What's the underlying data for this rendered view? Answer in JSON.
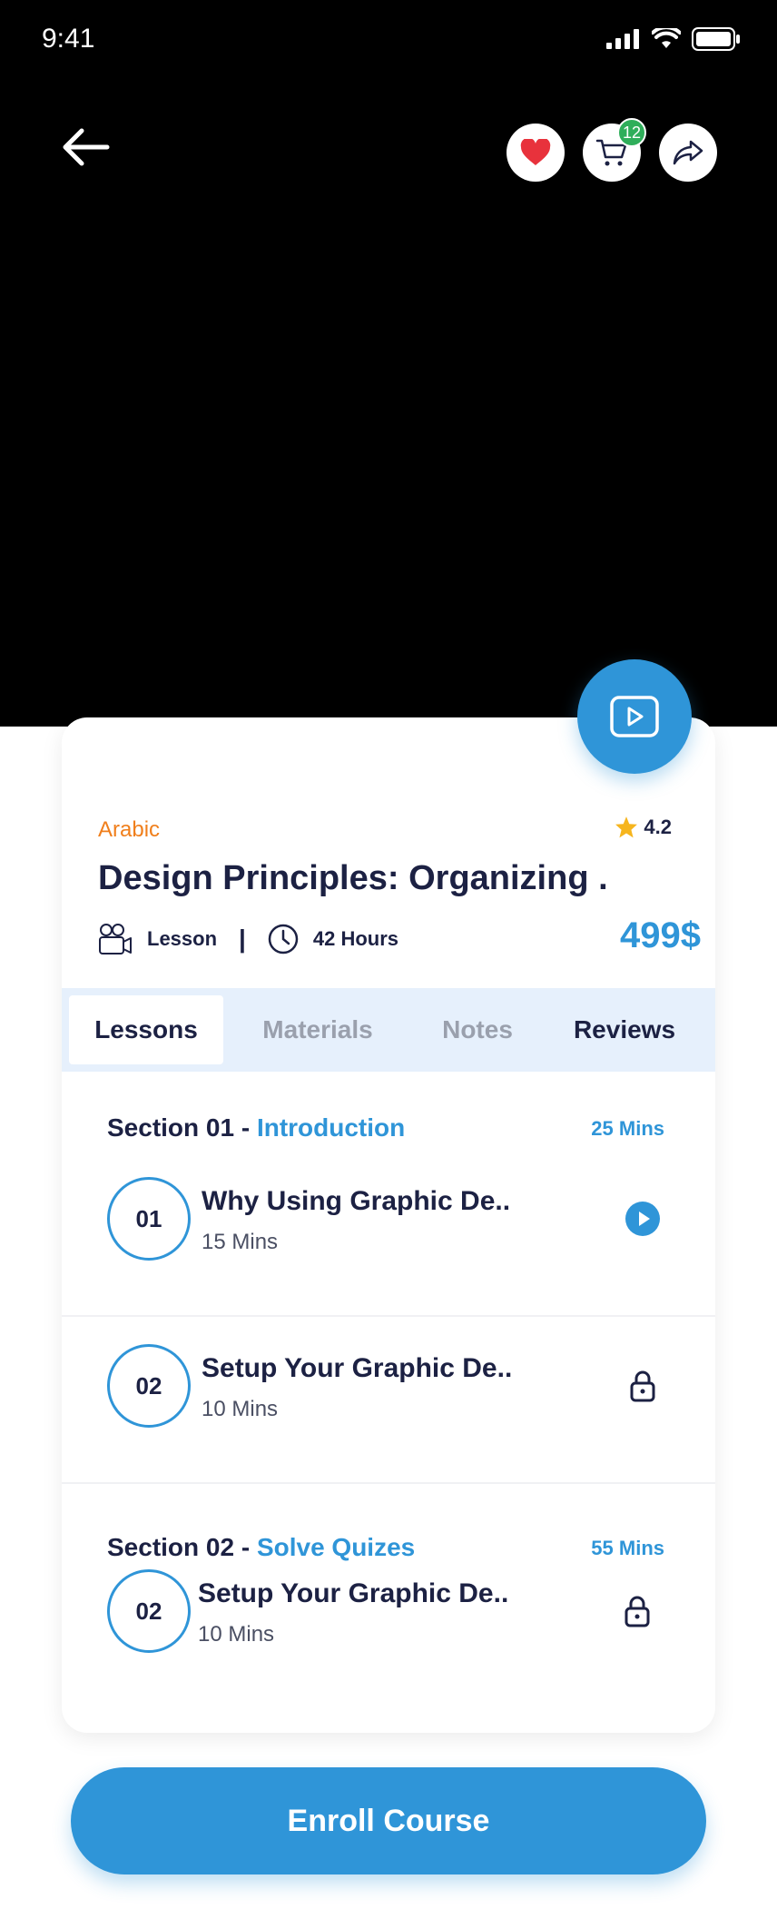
{
  "status": {
    "time": "9:41"
  },
  "header": {
    "cart_count": "12"
  },
  "course": {
    "language": "Arabic",
    "rating": "4.2",
    "title": "Design Principles: Organizing .",
    "lesson_label": "Lesson",
    "hours": "42 Hours",
    "price": "499$"
  },
  "tabs": [
    {
      "label": "Lessons"
    },
    {
      "label": "Materials"
    },
    {
      "label": "Notes"
    },
    {
      "label": "Reviews"
    }
  ],
  "sections": [
    {
      "prefix": "Section 01 - ",
      "name": "Introduction",
      "mins": "25 Mins",
      "lessons": [
        {
          "num": "01",
          "title": "Why Using Graphic De..",
          "duration": "15 Mins",
          "state": "play"
        },
        {
          "num": "02",
          "title": "Setup Your Graphic De..",
          "duration": "10 Mins",
          "state": "locked"
        }
      ]
    },
    {
      "prefix": "Section 02 - ",
      "name": "Solve Quizes",
      "mins": "55 Mins",
      "lessons": [
        {
          "num": "02",
          "title": "Setup Your Graphic De..",
          "duration": "10 Mins",
          "state": "locked"
        }
      ]
    }
  ],
  "enroll_label": "Enroll Course",
  "colors": {
    "accent": "#2f95d8",
    "orange": "#f07f1c",
    "heart": "#e8323c",
    "badge": "#2fae5a"
  }
}
